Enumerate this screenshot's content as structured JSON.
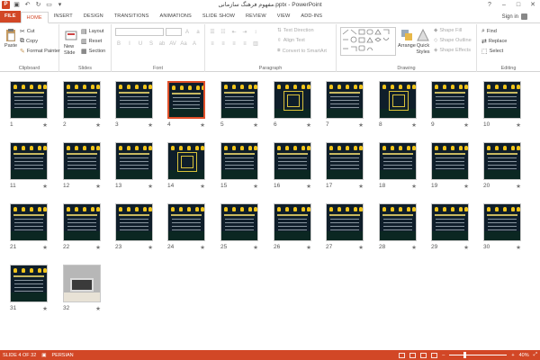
{
  "titlebar": {
    "app_logo": "P",
    "title": "مفهوم فرهنگ سازمانی.pptx - PowerPoint",
    "qat_icons": [
      "save-icon",
      "undo-icon",
      "redo-icon",
      "present-icon",
      "customize-icon"
    ],
    "controls": [
      "?",
      "–",
      "□",
      "✕"
    ]
  },
  "tabs": [
    "FILE",
    "HOME",
    "INSERT",
    "DESIGN",
    "TRANSITIONS",
    "ANIMATIONS",
    "SLIDE SHOW",
    "REVIEW",
    "VIEW",
    "ADD-INS"
  ],
  "active_tab": "HOME",
  "signin": "Sign in",
  "ribbon": {
    "clipboard": {
      "label": "Clipboard",
      "paste": "Paste",
      "cut": "Cut",
      "copy": "Copy",
      "format_painter": "Format Painter"
    },
    "slides": {
      "label": "Slides",
      "new_slide_line1": "New",
      "new_slide_line2": "Slide",
      "layout": "Layout",
      "reset": "Reset",
      "section": "Section"
    },
    "font": {
      "label": "Font"
    },
    "paragraph": {
      "label": "Paragraph",
      "text_direction": "Text Direction",
      "align_text": "Align Text",
      "convert_smartart": "Convert to SmartArt"
    },
    "drawing": {
      "label": "Drawing",
      "arrange": "Arrange",
      "quick_styles_line1": "Quick",
      "quick_styles_line2": "Styles",
      "shape_fill": "Shape Fill",
      "shape_outline": "Shape Outline",
      "shape_effects": "Shape Effects"
    },
    "editing": {
      "label": "Editing",
      "find": "Find",
      "replace": "Replace",
      "select": "Select"
    }
  },
  "slides": [
    {
      "n": "1",
      "star": "★"
    },
    {
      "n": "2",
      "star": "★"
    },
    {
      "n": "3",
      "star": "★"
    },
    {
      "n": "4",
      "star": "★"
    },
    {
      "n": "5",
      "star": "★"
    },
    {
      "n": "6",
      "star": "★"
    },
    {
      "n": "7",
      "star": "★"
    },
    {
      "n": "8",
      "star": "★"
    },
    {
      "n": "9",
      "star": "★"
    },
    {
      "n": "10",
      "star": "★"
    },
    {
      "n": "11",
      "star": "★"
    },
    {
      "n": "12",
      "star": "★"
    },
    {
      "n": "13",
      "star": "★"
    },
    {
      "n": "14",
      "star": "★"
    },
    {
      "n": "15",
      "star": "★"
    },
    {
      "n": "16",
      "star": "★"
    },
    {
      "n": "17",
      "star": "★"
    },
    {
      "n": "18",
      "star": "★"
    },
    {
      "n": "19",
      "star": "★"
    },
    {
      "n": "20",
      "star": "★"
    },
    {
      "n": "21",
      "star": "★"
    },
    {
      "n": "22",
      "star": "★"
    },
    {
      "n": "23",
      "star": "★"
    },
    {
      "n": "24",
      "star": "★"
    },
    {
      "n": "25",
      "star": "★"
    },
    {
      "n": "26",
      "star": "★"
    },
    {
      "n": "27",
      "star": "★"
    },
    {
      "n": "28",
      "star": "★"
    },
    {
      "n": "29",
      "star": "★"
    },
    {
      "n": "30",
      "star": "★"
    },
    {
      "n": "31",
      "star": "★"
    },
    {
      "n": "32",
      "star": "★"
    }
  ],
  "selected_slide": "4",
  "statusbar": {
    "slide_info": "SLIDE 4 OF 32",
    "language": "PERSIAN",
    "zoom": "40%",
    "zoom_out": "–",
    "zoom_in": "+"
  },
  "colors": {
    "accent": "#d24726",
    "slide_bg": "#0f1e2a",
    "slide_title": "#e7d36a"
  }
}
